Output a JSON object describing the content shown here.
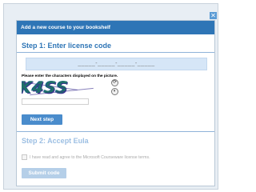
{
  "dialog": {
    "close_icon": "close-icon",
    "header_title": "Add a new course to your bookshelf"
  },
  "step1": {
    "title": "Step 1: Enter license code",
    "license_code_mask": "_____-_____-_____-_____",
    "captcha_prompt": "Please enter the characters displayed on the picture.",
    "captcha_text": "K4SS",
    "refresh_icon": "refresh-icon",
    "audio_icon": "audio-icon",
    "next_button": "Next step"
  },
  "step2": {
    "title": "Step 2: Accept Eula",
    "eula_label": "I have read and agree to the Microsoft Courseware license terms.",
    "submit_button": "Submit code"
  },
  "colors": {
    "header": "#2e75b6",
    "accent": "#4a8ccc",
    "disabled": "#b5cfe8"
  }
}
